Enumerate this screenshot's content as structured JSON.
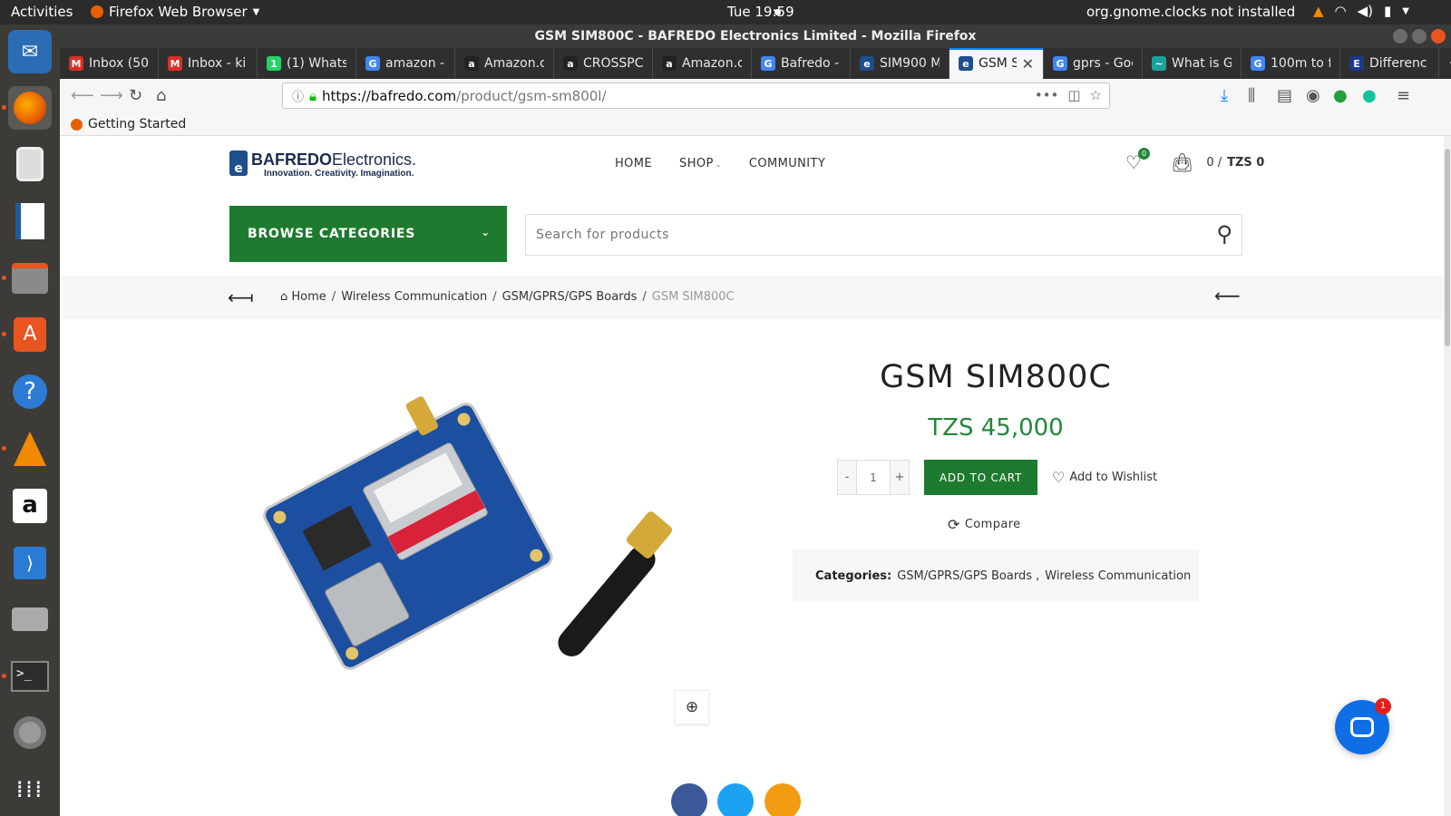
{
  "system": {
    "activities": "Activities",
    "app_name": "Firefox Web Browser",
    "clock": "Tue 19:59",
    "notification": "org.gnome.clocks not installed"
  },
  "dock": {
    "icons": [
      "thunderbird-icon",
      "firefox-icon",
      "rhythmbox-icon",
      "writer-icon",
      "files-icon",
      "software-center-icon",
      "help-icon",
      "vlc-icon",
      "amazon-icon",
      "vscode-icon",
      "disk-tool-icon",
      "terminal-icon",
      "settings-icon",
      "apps-grid-icon"
    ]
  },
  "window": {
    "title": "GSM SIM800C - BAFREDO Electronics Limited - Mozilla Firefox"
  },
  "tabs": [
    {
      "label": "Inbox (50",
      "color": "#d93025",
      "glyph": "M"
    },
    {
      "label": "Inbox - ki",
      "color": "#d93025",
      "glyph": "M"
    },
    {
      "label": "(1) Whats",
      "color": "#25d366",
      "glyph": "1"
    },
    {
      "label": "amazon -",
      "color": "#4285f4",
      "glyph": "G"
    },
    {
      "label": "Amazon.c",
      "color": "#222222",
      "glyph": "a"
    },
    {
      "label": "CROSSPC",
      "color": "#222222",
      "glyph": "a"
    },
    {
      "label": "Amazon.c",
      "color": "#222222",
      "glyph": "a"
    },
    {
      "label": "Bafredo -",
      "color": "#4285f4",
      "glyph": "G"
    },
    {
      "label": "SIM900 M",
      "color": "#1f4e8c",
      "glyph": "e"
    },
    {
      "label": "GSM SI",
      "color": "#1f4e8c",
      "glyph": "e",
      "active": true
    },
    {
      "label": "gprs - Goo",
      "color": "#4285f4",
      "glyph": "G"
    },
    {
      "label": "What is G",
      "color": "#1aa39a",
      "glyph": "~"
    },
    {
      "label": "100m to f",
      "color": "#4285f4",
      "glyph": "G"
    },
    {
      "label": "Differenc",
      "color": "#1a3a8a",
      "glyph": "E"
    }
  ],
  "urlbar": {
    "host": "https://bafredo.com",
    "path": "/product/gsm-sm800l/"
  },
  "bookmarks": {
    "getting_started": "Getting Started"
  },
  "site": {
    "logo_bold": "BAFREDO",
    "logo_light": "Electronics.",
    "logo_tagline": "Innovation.  Creativity.  Imagination.",
    "nav": {
      "home": "HOME",
      "shop": "SHOP",
      "community": "COMMUNITY"
    },
    "wishlist_count": "0",
    "cart_count": "0 /",
    "cart_total": "TZS 0",
    "browse_categories": "BROWSE CATEGORIES",
    "search_placeholder": "Search for products"
  },
  "breadcrumb": {
    "home": "Home",
    "level1": "Wireless Communication",
    "level2": "GSM/GPRS/GPS Boards",
    "current": "GSM SIM800C",
    "sep": "/"
  },
  "product": {
    "title": "GSM SIM800C",
    "price": "TZS 45,000",
    "qty_minus": "-",
    "qty_value": "1",
    "qty_plus": "+",
    "add_to_cart": "ADD TO CART",
    "add_to_wishlist": "Add to Wishlist",
    "compare": "Compare",
    "categories_label": "Categories:",
    "category_1": "GSM/GPRS/GPS Boards ,",
    "category_2": "Wireless Communication"
  },
  "share_colors": [
    "#3b5998",
    "#1da1f2",
    "#f39c12"
  ],
  "chat": {
    "badge": "1"
  },
  "colors": {
    "brand_green": "#1e7a2f",
    "price_green": "#22883a"
  }
}
